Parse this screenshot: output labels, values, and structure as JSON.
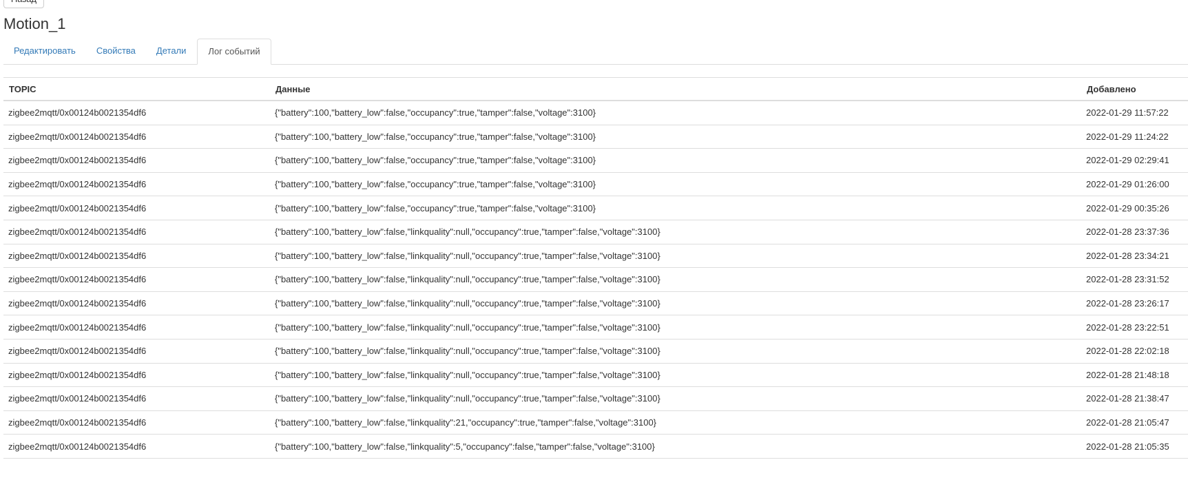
{
  "back_button": "Назад",
  "title": "Motion_1",
  "tabs": [
    {
      "label": "Редактировать",
      "active": false
    },
    {
      "label": "Свойства",
      "active": false
    },
    {
      "label": "Детали",
      "active": false
    },
    {
      "label": "Лог событий",
      "active": true
    }
  ],
  "table": {
    "headers": [
      "TOPIC",
      "Данные",
      "Добавлено"
    ],
    "rows": [
      [
        "zigbee2mqtt/0x00124b0021354df6",
        "{\"battery\":100,\"battery_low\":false,\"occupancy\":true,\"tamper\":false,\"voltage\":3100}",
        "2022-01-29 11:57:22"
      ],
      [
        "zigbee2mqtt/0x00124b0021354df6",
        "{\"battery\":100,\"battery_low\":false,\"occupancy\":true,\"tamper\":false,\"voltage\":3100}",
        "2022-01-29 11:24:22"
      ],
      [
        "zigbee2mqtt/0x00124b0021354df6",
        "{\"battery\":100,\"battery_low\":false,\"occupancy\":true,\"tamper\":false,\"voltage\":3100}",
        "2022-01-29 02:29:41"
      ],
      [
        "zigbee2mqtt/0x00124b0021354df6",
        "{\"battery\":100,\"battery_low\":false,\"occupancy\":true,\"tamper\":false,\"voltage\":3100}",
        "2022-01-29 01:26:00"
      ],
      [
        "zigbee2mqtt/0x00124b0021354df6",
        "{\"battery\":100,\"battery_low\":false,\"occupancy\":true,\"tamper\":false,\"voltage\":3100}",
        "2022-01-29 00:35:26"
      ],
      [
        "zigbee2mqtt/0x00124b0021354df6",
        "{\"battery\":100,\"battery_low\":false,\"linkquality\":null,\"occupancy\":true,\"tamper\":false,\"voltage\":3100}",
        "2022-01-28 23:37:36"
      ],
      [
        "zigbee2mqtt/0x00124b0021354df6",
        "{\"battery\":100,\"battery_low\":false,\"linkquality\":null,\"occupancy\":true,\"tamper\":false,\"voltage\":3100}",
        "2022-01-28 23:34:21"
      ],
      [
        "zigbee2mqtt/0x00124b0021354df6",
        "{\"battery\":100,\"battery_low\":false,\"linkquality\":null,\"occupancy\":true,\"tamper\":false,\"voltage\":3100}",
        "2022-01-28 23:31:52"
      ],
      [
        "zigbee2mqtt/0x00124b0021354df6",
        "{\"battery\":100,\"battery_low\":false,\"linkquality\":null,\"occupancy\":true,\"tamper\":false,\"voltage\":3100}",
        "2022-01-28 23:26:17"
      ],
      [
        "zigbee2mqtt/0x00124b0021354df6",
        "{\"battery\":100,\"battery_low\":false,\"linkquality\":null,\"occupancy\":true,\"tamper\":false,\"voltage\":3100}",
        "2022-01-28 23:22:51"
      ],
      [
        "zigbee2mqtt/0x00124b0021354df6",
        "{\"battery\":100,\"battery_low\":false,\"linkquality\":null,\"occupancy\":true,\"tamper\":false,\"voltage\":3100}",
        "2022-01-28 22:02:18"
      ],
      [
        "zigbee2mqtt/0x00124b0021354df6",
        "{\"battery\":100,\"battery_low\":false,\"linkquality\":null,\"occupancy\":true,\"tamper\":false,\"voltage\":3100}",
        "2022-01-28 21:48:18"
      ],
      [
        "zigbee2mqtt/0x00124b0021354df6",
        "{\"battery\":100,\"battery_low\":false,\"linkquality\":null,\"occupancy\":true,\"tamper\":false,\"voltage\":3100}",
        "2022-01-28 21:38:47"
      ],
      [
        "zigbee2mqtt/0x00124b0021354df6",
        "{\"battery\":100,\"battery_low\":false,\"linkquality\":21,\"occupancy\":true,\"tamper\":false,\"voltage\":3100}",
        "2022-01-28 21:05:47"
      ],
      [
        "zigbee2mqtt/0x00124b0021354df6",
        "{\"battery\":100,\"battery_low\":false,\"linkquality\":5,\"occupancy\":false,\"tamper\":false,\"voltage\":3100}",
        "2022-01-28 21:05:35"
      ]
    ]
  }
}
